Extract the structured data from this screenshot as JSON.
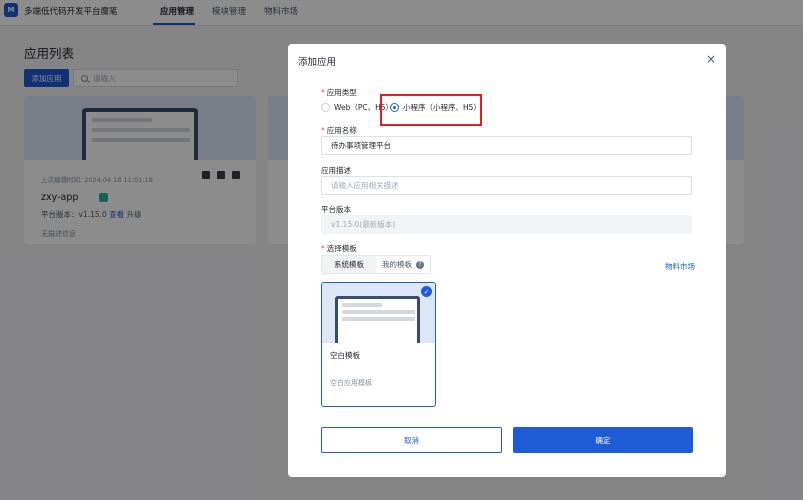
{
  "app": {
    "brand": "多端低代码开发平台魔笔",
    "logo_text": "M",
    "nav": [
      "应用管理",
      "模块管理",
      "物料市场"
    ],
    "page_title": "应用列表",
    "add_button": "添加应用",
    "search_placeholder": "请输入"
  },
  "card": {
    "last_edited": "上次编辑时间: 2024.04.18 11:01:18",
    "name": "zxy-app",
    "version_label": "平台版本：v1.15.0",
    "view_link": "查看",
    "upgrade": "升级",
    "description": "无描述信息"
  },
  "modal": {
    "title": "添加应用",
    "close": "×",
    "app_type_label": "应用类型",
    "app_type_options": [
      "Web（PC、H5）",
      "小程序（小程序、H5）"
    ],
    "app_type_selected": "小程序（小程序、H5）",
    "app_name_label": "应用名称",
    "app_name_value": "待办事项管理平台",
    "app_desc_label": "应用描述",
    "app_desc_placeholder": "请输入应用相关描述",
    "platform_version_label": "平台版本",
    "platform_version_value": "v1.15.0(最新版本)",
    "template_label": "选择模板",
    "template_tabs": [
      "系统模板",
      "我的模板"
    ],
    "help_icon": "?",
    "market_link": "物料市场",
    "template": {
      "name": "空白模板",
      "description": "空白应用模板",
      "check_icon": "✓"
    },
    "cancel_button": "取消",
    "ok_button": "确定"
  },
  "colors": {
    "primary": "#1e5bd6",
    "highlight": "#e02020"
  }
}
